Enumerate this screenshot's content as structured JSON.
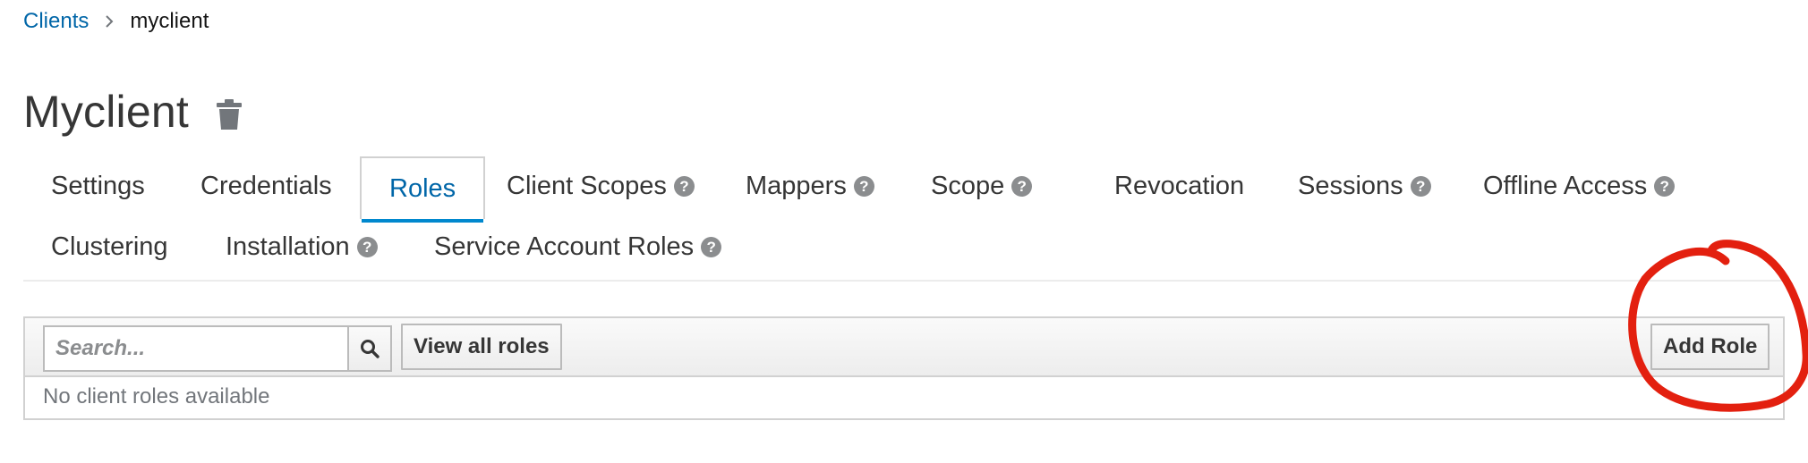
{
  "breadcrumb": {
    "parent": "Clients",
    "current": "myclient"
  },
  "page": {
    "title": "Myclient"
  },
  "tabs": [
    {
      "label": "Settings",
      "help": false
    },
    {
      "label": "Credentials",
      "help": false
    },
    {
      "label": "Roles",
      "help": false,
      "active": true
    },
    {
      "label": "Client Scopes",
      "help": true
    },
    {
      "label": "Mappers",
      "help": true
    },
    {
      "label": "Scope",
      "help": true
    },
    {
      "label": "Revocation",
      "help": false
    },
    {
      "label": "Sessions",
      "help": true
    },
    {
      "label": "Offline Access",
      "help": true
    },
    {
      "label": "Clustering",
      "help": false
    },
    {
      "label": "Installation",
      "help": true
    },
    {
      "label": "Service Account Roles",
      "help": true
    }
  ],
  "help_glyph": "?",
  "toolbar": {
    "search_placeholder": "Search...",
    "view_all_label": "View all roles",
    "add_role_label": "Add Role"
  },
  "table": {
    "empty_message": "No client roles available"
  },
  "colors": {
    "link": "#0066a8",
    "active_tab_underline": "#0088ce",
    "annotation_red": "#e3200f"
  },
  "icons": {
    "trash": "trash-icon",
    "breadcrumb_separator": "chevron-right-icon",
    "search": "search-icon",
    "help": "question-circle-icon"
  }
}
